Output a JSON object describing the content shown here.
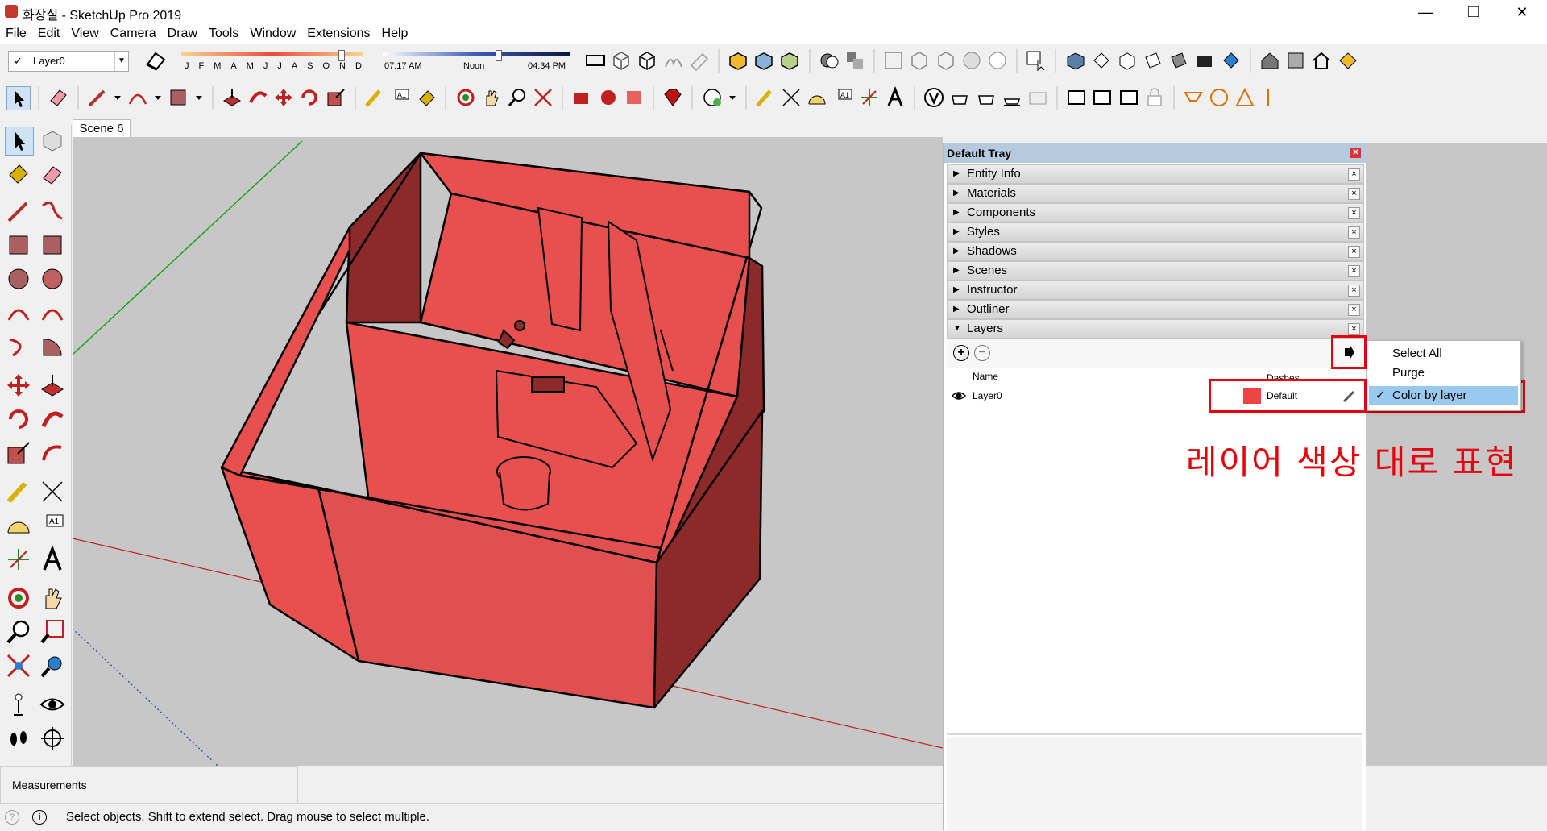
{
  "window": {
    "title": "화장실 - SketchUp Pro 2019",
    "minimize": "—",
    "maximize": "❐",
    "close": "✕"
  },
  "menu": [
    "File",
    "Edit",
    "View",
    "Camera",
    "Draw",
    "Tools",
    "Window",
    "Extensions",
    "Help"
  ],
  "layer_toolbar": {
    "current_layer": "Layer0"
  },
  "shadow_toolbar": {
    "months": [
      "J",
      "F",
      "M",
      "A",
      "M",
      "J",
      "J",
      "A",
      "S",
      "O",
      "N",
      "D"
    ],
    "time_start": "07:17 AM",
    "time_mid": "Noon",
    "time_end": "04:34 PM"
  },
  "scene_tab": {
    "label": "Scene 6"
  },
  "tray": {
    "title": "Default Tray",
    "panels": [
      {
        "label": "Entity Info",
        "expanded": false
      },
      {
        "label": "Materials",
        "expanded": false
      },
      {
        "label": "Components",
        "expanded": false
      },
      {
        "label": "Styles",
        "expanded": false
      },
      {
        "label": "Shadows",
        "expanded": false
      },
      {
        "label": "Scenes",
        "expanded": false
      },
      {
        "label": "Instructor",
        "expanded": false
      },
      {
        "label": "Outliner",
        "expanded": false
      },
      {
        "label": "Layers",
        "expanded": true
      }
    ],
    "layers": {
      "columns": {
        "name": "Name",
        "dashes": "Dashes"
      },
      "rows": [
        {
          "name": "Layer0",
          "color": "#ee4444",
          "dashes": "Default",
          "visible": true
        }
      ]
    }
  },
  "details_menu": {
    "items": [
      {
        "label": "Select All",
        "checked": false
      },
      {
        "label": "Purge",
        "checked": false
      },
      {
        "label": "Color by layer",
        "checked": true,
        "highlighted": true
      }
    ]
  },
  "annotation": {
    "text": "레이어 색상 대로 표현",
    "color": "#e8000c"
  },
  "measurements": {
    "label": "Measurements"
  },
  "status": {
    "hint": "Select objects. Shift to extend select. Drag mouse to select multiple."
  },
  "colors": {
    "model_red": "#e85050",
    "model_dark": "#8c2a2a",
    "highlight_blue": "#99c9ef",
    "tray_header": "#b7c9dc"
  }
}
